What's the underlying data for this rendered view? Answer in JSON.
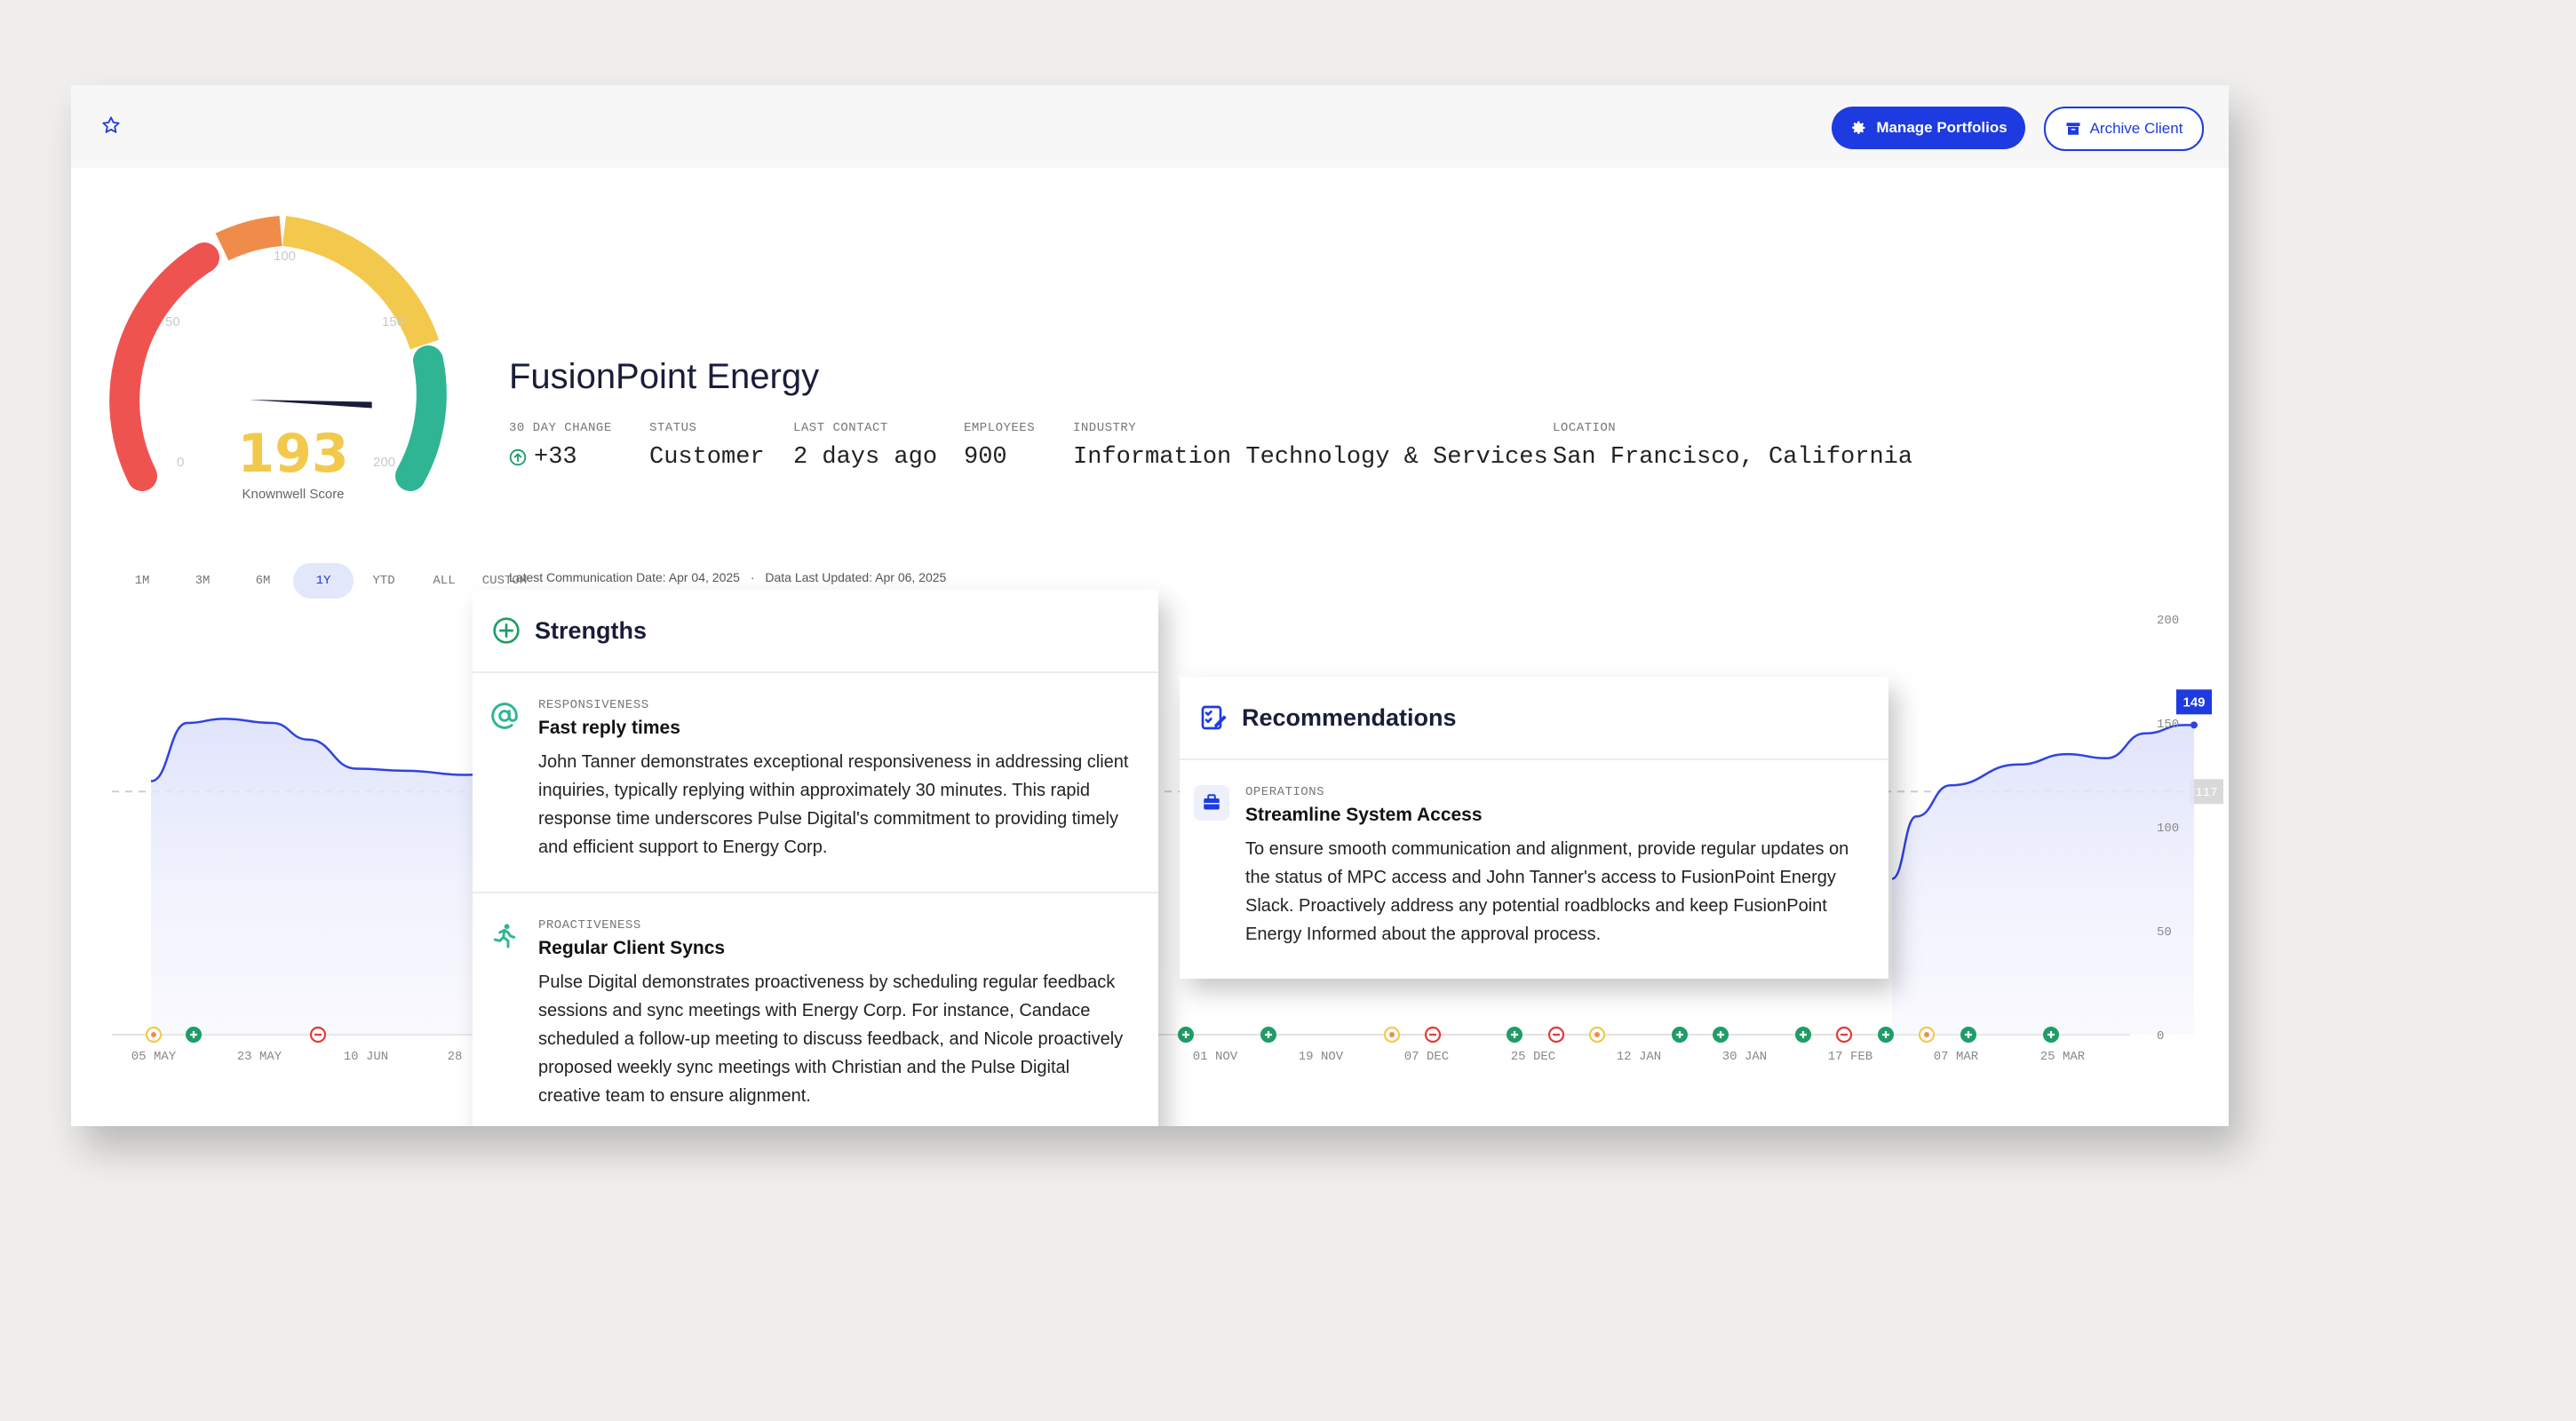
{
  "header": {
    "manage_label": "Manage Portfolios",
    "archive_label": "Archive Client"
  },
  "gauge": {
    "score": "193",
    "label": "Knownwell Score",
    "ticks": [
      "0",
      "50",
      "100",
      "150",
      "200"
    ],
    "value_fraction": 0.965,
    "colors": {
      "low": "#ef5350",
      "mid_low": "#f08c4a",
      "mid": "#f2c94c",
      "high": "#2fb593"
    }
  },
  "client": {
    "name": "FusionPoint Energy",
    "change_label": "30 DAY CHANGE",
    "change_value": "+33",
    "status_label": "STATUS",
    "status_value": "Customer",
    "contact_label": "LAST CONTACT",
    "contact_value": "2 days ago",
    "employees_label": "EMPLOYEES",
    "employees_value": "900",
    "industry_label": "INDUSTRY",
    "industry_value": "Information Technology & Services",
    "location_label": "LOCATION",
    "location_value": "San Francisco, California",
    "latest_comm": "Latest Communication Date: Apr 04, 2025",
    "separator": "·",
    "data_updated": "Data Last Updated: Apr 06, 2025"
  },
  "ranges": [
    "1M",
    "3M",
    "6M",
    "1Y",
    "YTD",
    "ALL",
    "CUSTOM"
  ],
  "active_range": "1Y",
  "chart_data": {
    "type": "area",
    "y_ticks": [
      "0",
      "50",
      "100",
      "150",
      "200"
    ],
    "ylim": [
      0,
      200
    ],
    "x_ticks": [
      "05 MAY",
      "23 MAY",
      "10 JUN",
      "28",
      "01 NOV",
      "19 NOV",
      "07 DEC",
      "25 DEC",
      "12 JAN",
      "30 JAN",
      "17 FEB",
      "07 MAR",
      "25 MAR"
    ],
    "reference_value": 117,
    "current_value": 149,
    "reference_label": "117",
    "current_label": "149",
    "series_left": [
      [
        0,
        122
      ],
      [
        0.06,
        150
      ],
      [
        0.12,
        152
      ],
      [
        0.2,
        150
      ],
      [
        0.26,
        142
      ],
      [
        0.34,
        128
      ],
      [
        0.42,
        127
      ],
      [
        0.52,
        125
      ],
      [
        0.58,
        126
      ]
    ],
    "series_right": [
      [
        0.0,
        75
      ],
      [
        0.05,
        105
      ],
      [
        0.12,
        120
      ],
      [
        0.26,
        130
      ],
      [
        0.36,
        135
      ],
      [
        0.44,
        133
      ],
      [
        0.52,
        145
      ],
      [
        0.6,
        149
      ],
      [
        0.62,
        149
      ]
    ],
    "accent": "#2f43e0"
  },
  "strengths": {
    "title": "Strengths",
    "items": [
      {
        "category": "RESPONSIVENESS",
        "title": "Fast reply times",
        "body": "John Tanner demonstrates exceptional responsiveness in addressing client inquiries, typically replying within approximately 30 minutes. This rapid response time underscores Pulse Digital's commitment to providing timely and efficient support to Energy Corp."
      },
      {
        "category": "PROACTIVENESS",
        "title": "Regular Client Syncs",
        "body": "Pulse Digital demonstrates proactiveness by scheduling regular feedback sessions and sync meetings with Energy Corp. For instance, Candace scheduled a follow-up meeting to discuss feedback, and Nicole proactively proposed weekly sync meetings with Christian and the Pulse Digital creative team to ensure alignment."
      }
    ]
  },
  "recommendations": {
    "title": "Recommendations",
    "items": [
      {
        "category": "OPERATIONS",
        "title": "Streamline System Access",
        "body": "To ensure smooth communication and alignment, provide regular updates on the status of MPC access and John Tanner's access to FusionPoint Energy Slack. Proactively address any potential roadblocks and keep FusionPoint Energy Informed about the approval process."
      }
    ]
  }
}
